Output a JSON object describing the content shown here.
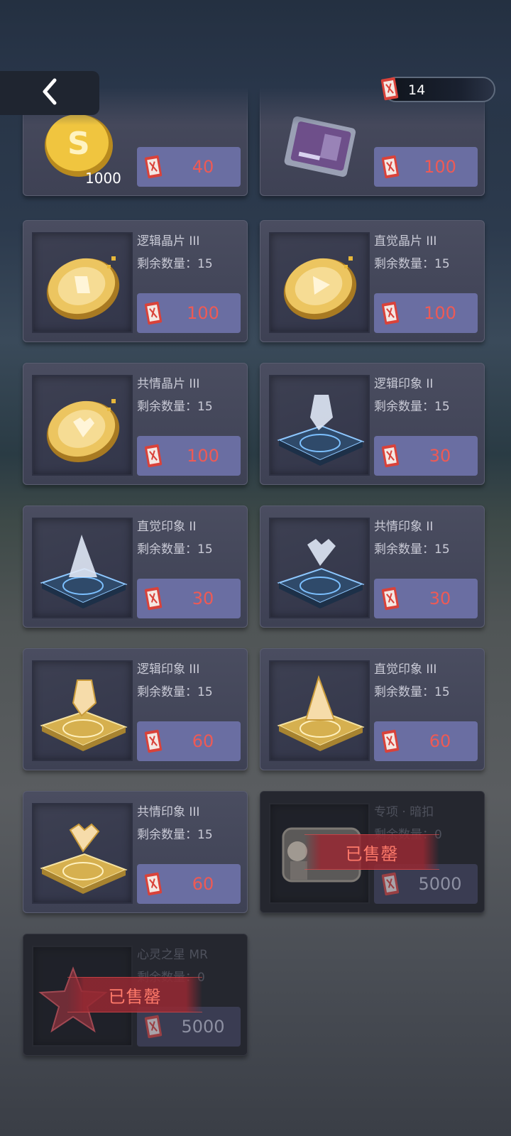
{
  "header": {
    "back_icon": "chevron-left-icon",
    "currency_icon": "ticket-icon",
    "currency_amount": "14"
  },
  "items": [
    {
      "name": "",
      "stock": "",
      "price": "40",
      "thumb_caption": "1000",
      "icon": "gold-coin-icon",
      "sold": false
    },
    {
      "name": "",
      "stock": "",
      "price": "100",
      "icon": "chip-icon",
      "sold": false
    },
    {
      "name": "逻辑晶片 III",
      "stock": "剩余数量：15",
      "price": "100",
      "icon": "logic-chip-coin-icon",
      "sold": false
    },
    {
      "name": "直觉晶片 III",
      "stock": "剩余数量：15",
      "price": "100",
      "icon": "intuition-chip-coin-icon",
      "sold": false
    },
    {
      "name": "共情晶片 III",
      "stock": "剩余数量：15",
      "price": "100",
      "icon": "empathy-chip-coin-icon",
      "sold": false
    },
    {
      "name": "逻辑印象 II",
      "stock": "剩余数量：15",
      "price": "30",
      "icon": "logic-impression-blue-icon",
      "sold": false
    },
    {
      "name": "直觉印象 II",
      "stock": "剩余数量：15",
      "price": "30",
      "icon": "intuition-impression-blue-icon",
      "sold": false
    },
    {
      "name": "共情印象 II",
      "stock": "剩余数量：15",
      "price": "30",
      "icon": "empathy-impression-blue-icon",
      "sold": false
    },
    {
      "name": "逻辑印象 III",
      "stock": "剩余数量：15",
      "price": "60",
      "icon": "logic-impression-gold-icon",
      "sold": false
    },
    {
      "name": "直觉印象 III",
      "stock": "剩余数量：15",
      "price": "60",
      "icon": "intuition-impression-gold-icon",
      "sold": false
    },
    {
      "name": "共情印象 III",
      "stock": "剩余数量：15",
      "price": "60",
      "icon": "empathy-impression-gold-icon",
      "sold": false
    },
    {
      "name": "专项 · 暗扣",
      "stock": "剩余数量：0",
      "price": "5000",
      "icon": "portrait-card-icon",
      "sold": true,
      "sold_label": "已售罄"
    },
    {
      "name": "心灵之星 MR",
      "stock": "剩余数量：0",
      "price": "5000",
      "icon": "red-star-icon",
      "sold": true,
      "sold_label": "已售罄"
    }
  ],
  "colors": {
    "price_text": "#ee5a55",
    "price_bg": "#6a6ea2",
    "sold_stamp": "#963240"
  }
}
